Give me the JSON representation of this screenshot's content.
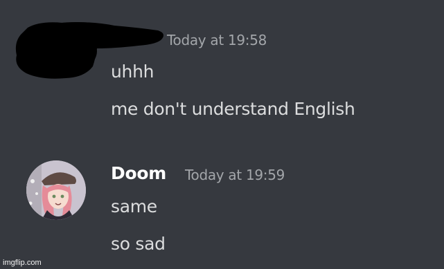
{
  "messages": [
    {
      "author": "",
      "timestamp": "Today at 19:58",
      "lines": [
        "uhhh",
        "me don't understand English"
      ]
    },
    {
      "author": "Doom",
      "timestamp": "Today at 19:59",
      "lines": [
        "same",
        "so sad"
      ]
    }
  ],
  "icons": {
    "redaction": "redaction-scribble",
    "avatar": "user-avatar"
  },
  "watermark": "imgflip.com",
  "colors": {
    "background": "#36393f",
    "username": "#ffffff",
    "message_text": "#dcddde",
    "timestamp": "#a3a6aa"
  }
}
